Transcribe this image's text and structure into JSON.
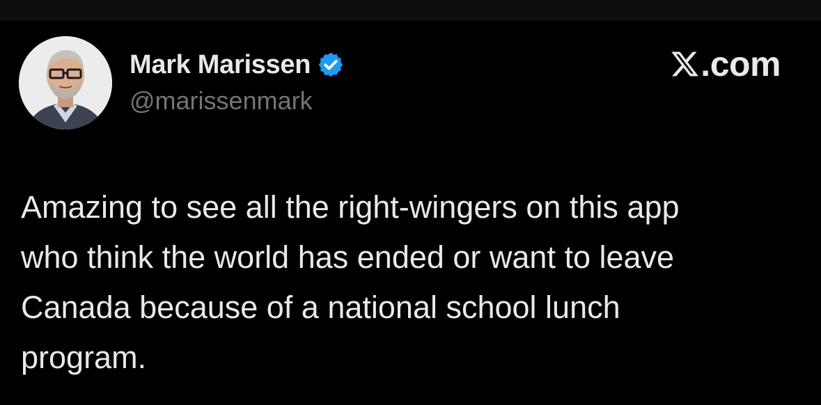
{
  "author": {
    "display_name": "Mark Marissen",
    "handle": "@marissenmark",
    "verified": true,
    "verified_icon": "verified-badge-icon",
    "avatar_icon": "profile-photo"
  },
  "brand": {
    "logo_icon": "x-logo-icon",
    "suffix": ".com"
  },
  "tweet": {
    "text": "Amazing to see all the right-wingers on this app\nwho think the world has ended or want to leave\nCanada because of a national school lunch\nprogram."
  },
  "colors": {
    "background": "#000000",
    "primary_text": "#e7e9ea",
    "secondary_text": "#71767b",
    "verified_blue": "#1d9bf0"
  }
}
